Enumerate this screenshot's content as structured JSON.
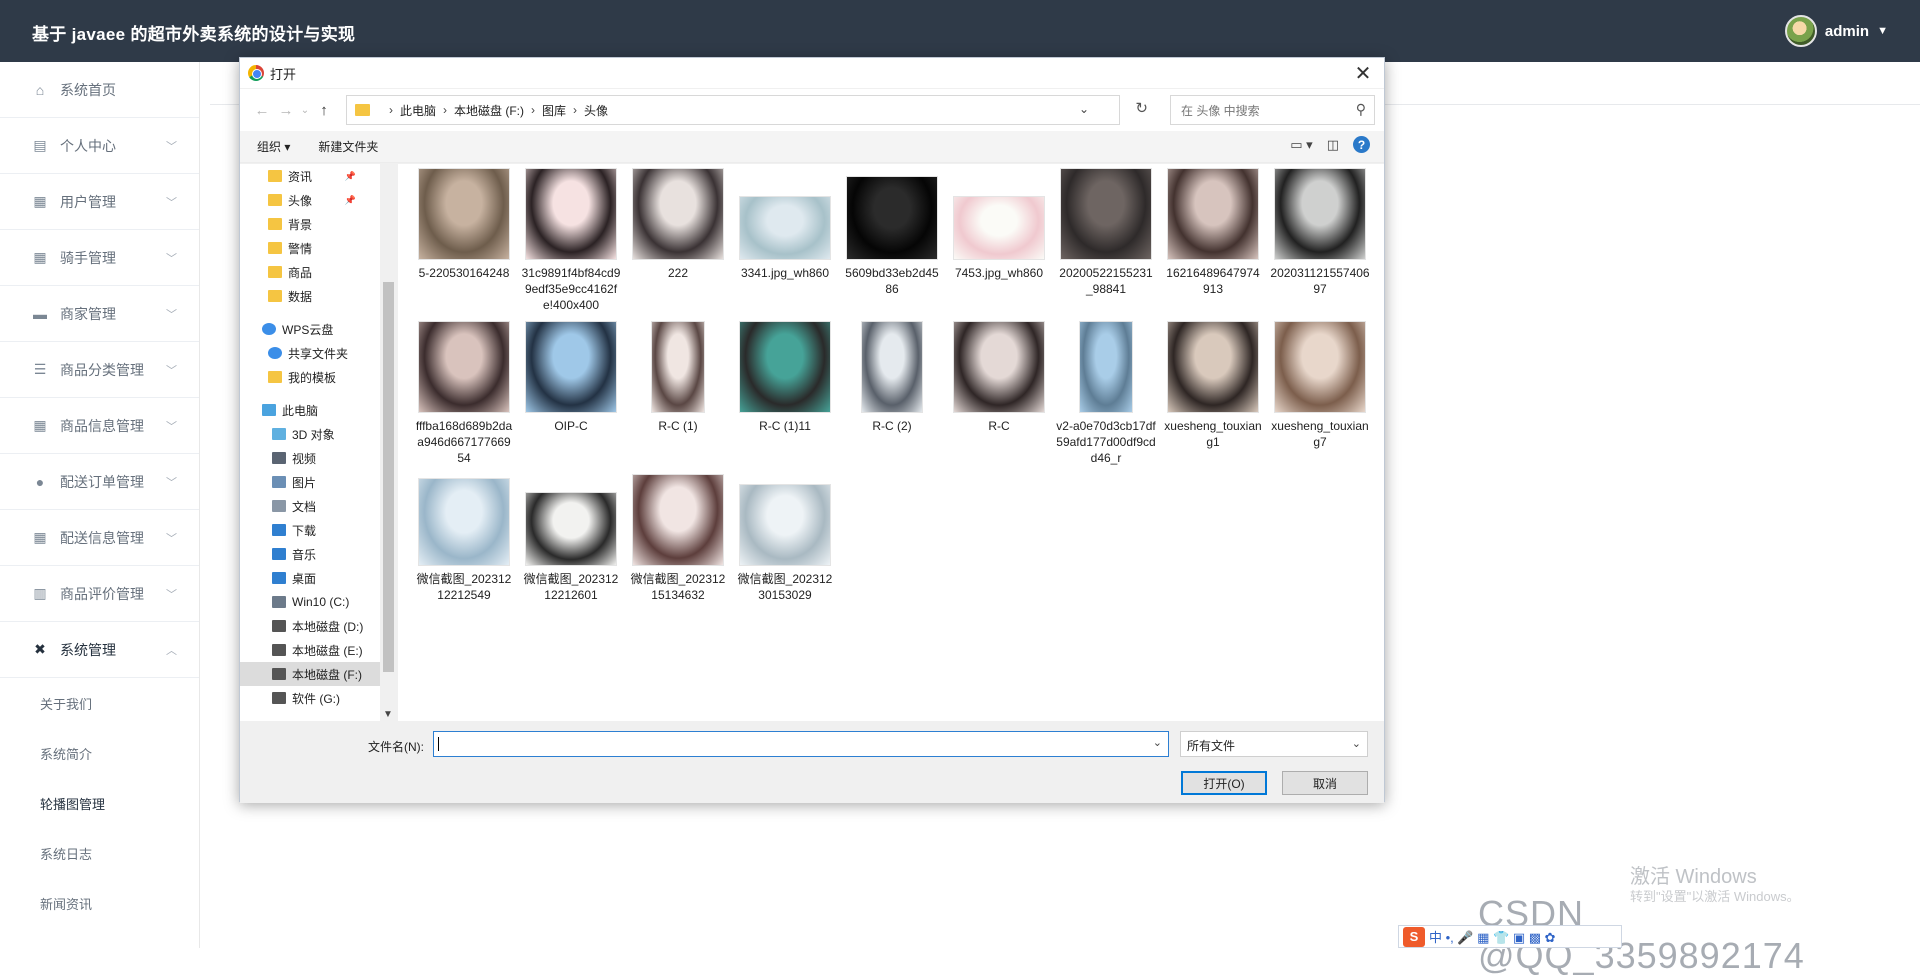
{
  "app": {
    "title": "基于 javaee 的超市外卖系统的设计与实现",
    "user": "admin",
    "user_caret": "▼"
  },
  "sidebar": {
    "items": [
      {
        "label": "系统首页",
        "icon": "home-icon",
        "glyph": "⌂",
        "chevron": false
      },
      {
        "label": "个人中心",
        "icon": "profile-icon",
        "glyph": "▤",
        "chevron": true
      },
      {
        "label": "用户管理",
        "icon": "grid-icon",
        "glyph": "▦",
        "chevron": true
      },
      {
        "label": "骑手管理",
        "icon": "grid-icon",
        "glyph": "▦",
        "chevron": true
      },
      {
        "label": "商家管理",
        "icon": "briefcase-icon",
        "glyph": "▬",
        "chevron": true
      },
      {
        "label": "商品分类管理",
        "icon": "list-icon",
        "glyph": "☰",
        "chevron": true
      },
      {
        "label": "商品信息管理",
        "icon": "grid-icon",
        "glyph": "▦",
        "chevron": true
      },
      {
        "label": "配送订单管理",
        "icon": "balloon-icon",
        "glyph": "●",
        "chevron": true
      },
      {
        "label": "配送信息管理",
        "icon": "grid-icon",
        "glyph": "▦",
        "chevron": true
      },
      {
        "label": "商品评价管理",
        "icon": "bar-chart-icon",
        "glyph": "▥",
        "chevron": true
      },
      {
        "label": "系统管理",
        "icon": "settings-icon",
        "glyph": "✖",
        "chevron": true,
        "expanded": true
      }
    ],
    "sub_items": [
      "关于我们",
      "系统简介",
      "轮播图管理",
      "系统日志",
      "新闻资讯"
    ],
    "chevron_down": "﹀",
    "chevron_up": "︿"
  },
  "dialog": {
    "title": "打开",
    "close": "✕",
    "nav": {
      "back": "←",
      "forward": "→",
      "up": "↑",
      "refresh": "↻",
      "dropdown": "⌄",
      "sep": "›"
    },
    "breadcrumb": [
      "此电脑",
      "本地磁盘 (F:)",
      "图库",
      "头像"
    ],
    "search_placeholder": "在 头像 中搜索",
    "search_glyph": "⚲",
    "toolbar": {
      "organize": "组织 ▾",
      "new_folder": "新建文件夹",
      "view_glyph": "▭ ▾",
      "pane_glyph": "◫",
      "help": "?"
    },
    "tree": [
      {
        "label": "资讯",
        "icon": "folder-icon",
        "color": "#f5c542",
        "indent": 28,
        "pinned": true
      },
      {
        "label": "头像",
        "icon": "folder-icon",
        "color": "#f5c542",
        "indent": 28,
        "pinned": true
      },
      {
        "label": "背景",
        "icon": "folder-icon",
        "color": "#f5c542",
        "indent": 28
      },
      {
        "label": "警情",
        "icon": "folder-icon",
        "color": "#f5c542",
        "indent": 28
      },
      {
        "label": "商品",
        "icon": "folder-icon",
        "color": "#f5c542",
        "indent": 28
      },
      {
        "label": "数据",
        "icon": "folder-icon",
        "color": "#f5c542",
        "indent": 28
      },
      {
        "label": "",
        "spacer": true
      },
      {
        "label": "WPS云盘",
        "icon": "cloud-icon",
        "color": "#3b8ee8",
        "indent": 22
      },
      {
        "label": "共享文件夹",
        "icon": "share-icon",
        "color": "#3b8ee8",
        "indent": 28
      },
      {
        "label": "我的模板",
        "icon": "folder-icon",
        "color": "#f5c542",
        "indent": 28
      },
      {
        "label": "",
        "spacer": true
      },
      {
        "label": "此电脑",
        "icon": "computer-icon",
        "color": "#4aa3df",
        "indent": 22
      },
      {
        "label": "3D 对象",
        "icon": "cube-icon",
        "color": "#5fb0e0",
        "indent": 32
      },
      {
        "label": "视频",
        "icon": "video-icon",
        "color": "#5a6472",
        "indent": 32
      },
      {
        "label": "图片",
        "icon": "picture-icon",
        "color": "#6b8fb5",
        "indent": 32
      },
      {
        "label": "文档",
        "icon": "document-icon",
        "color": "#8a97a6",
        "indent": 32
      },
      {
        "label": "下载",
        "icon": "download-icon",
        "color": "#2f7fd0",
        "indent": 32
      },
      {
        "label": "音乐",
        "icon": "music-icon",
        "color": "#2f7fd0",
        "indent": 32
      },
      {
        "label": "桌面",
        "icon": "desktop-icon",
        "color": "#2f7fd0",
        "indent": 32
      },
      {
        "label": "Win10 (C:)",
        "icon": "drive-icon",
        "color": "#6c7a8a",
        "indent": 32
      },
      {
        "label": "本地磁盘 (D:)",
        "icon": "drive-icon",
        "color": "#555",
        "indent": 32
      },
      {
        "label": "本地磁盘 (E:)",
        "icon": "drive-icon",
        "color": "#555",
        "indent": 32
      },
      {
        "label": "本地磁盘 (F:)",
        "icon": "drive-icon",
        "color": "#555",
        "indent": 32,
        "selected": true
      },
      {
        "label": "软件 (G:)",
        "icon": "drive-icon",
        "color": "#555",
        "indent": 32
      }
    ],
    "scroll_down": "▼",
    "files": [
      {
        "name": "5-220530164248",
        "c1": "#c7b2a0",
        "c2": "#6e5d4c"
      },
      {
        "name": "31c9891f4bf84cd99edf35e9cc4162fe!400x400",
        "c1": "#f6e2e2",
        "c2": "#2b2224"
      },
      {
        "name": "222",
        "c1": "#e8e1de",
        "c2": "#3a3234"
      },
      {
        "name": "3341.jpg_wh860",
        "c1": "#dfe9ef",
        "c2": "#a7c1c9"
      },
      {
        "name": "5609bd33eb2d4586",
        "c1": "#2b2b2b",
        "c2": "#050505"
      },
      {
        "name": "7453.jpg_wh860",
        "c1": "#fbfbf7",
        "c2": "#f0c9cf"
      },
      {
        "name": "20200522155231_98841",
        "c1": "#6e6562",
        "c2": "#2e2a2a"
      },
      {
        "name": "16216489647974913",
        "c1": "#d7c4be",
        "c2": "#43322f"
      },
      {
        "name": "20203112155740697",
        "c1": "#cfd0cf",
        "c2": "#212121"
      },
      {
        "name": "fffba168d689b2daa946d66717766954",
        "c1": "#d9c3bd",
        "c2": "#3b2c2d"
      },
      {
        "name": "OIP-C",
        "c1": "#9fc8e8",
        "c2": "#233244"
      },
      {
        "name": "R-C (1)",
        "c1": "#f0e6e2",
        "c2": "#5a4744"
      },
      {
        "name": "R-C (1)11",
        "c1": "#46a398",
        "c2": "#2a2a2a"
      },
      {
        "name": "R-C (2)",
        "c1": "#e5eaee",
        "c2": "#59606a"
      },
      {
        "name": "R-C",
        "c1": "#e4d9d6",
        "c2": "#2f2626"
      },
      {
        "name": "v2-a0e70d3cb17df59afd177d00df9cdd46_r",
        "c1": "#a9cde8",
        "c2": "#5e7d95"
      },
      {
        "name": "xuesheng_touxiang1",
        "c1": "#d9c9bc",
        "c2": "#2e2624"
      },
      {
        "name": "xuesheng_touxiang7",
        "c1": "#e8d7cb",
        "c2": "#7c5e4c"
      },
      {
        "name": "微信截图_20231212212549",
        "c1": "#e4eef5",
        "c2": "#9ab6c9"
      },
      {
        "name": "微信截图_20231212212601",
        "c1": "#f2f2f0",
        "c2": "#2a2a2a"
      },
      {
        "name": "微信截图_20231215134632",
        "c1": "#f1e5e3",
        "c2": "#5d3e3c"
      },
      {
        "name": "微信截图_20231230153029",
        "c1": "#eef3f6",
        "c2": "#a9b9c2"
      }
    ],
    "filename_label": "文件名(N):",
    "filename_value": "",
    "filter": "所有文件",
    "open": "打开(O)",
    "cancel": "取消"
  },
  "os_watermark": {
    "line1": "激活 Windows",
    "line2": "转到\"设置\"以激活 Windows。"
  },
  "csdn_watermark": "CSDN @QQ_3359892174",
  "ime_bar": {
    "logo": "S",
    "text": "中 •, 🎤 ▦ 👕 ▣ ▩ ✿"
  }
}
